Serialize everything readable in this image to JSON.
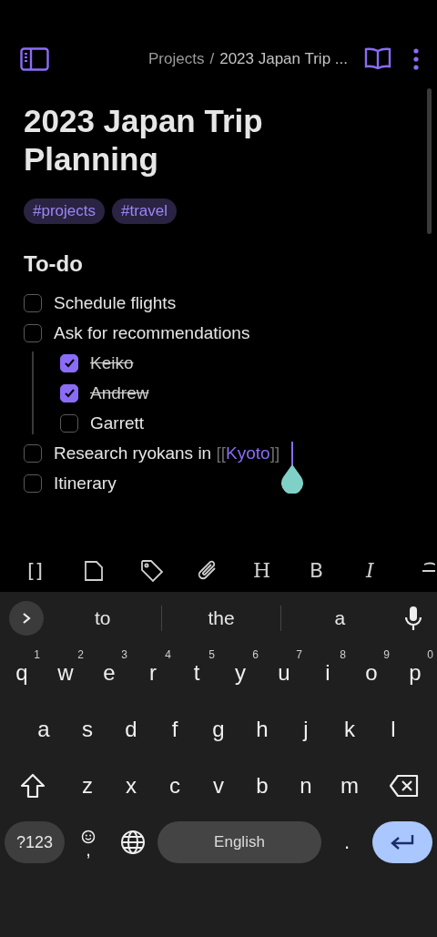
{
  "header": {
    "breadcrumb": [
      {
        "label": "Projects"
      },
      {
        "label": "2023 Japan Trip ..."
      }
    ],
    "separator": "/"
  },
  "note": {
    "title": "2023 Japan Trip Planning",
    "tags": [
      "#projects",
      "#travel"
    ],
    "heading": "To-do",
    "tasks": [
      {
        "text": "Schedule flights",
        "checked": false
      },
      {
        "text": "Ask for recommendations",
        "checked": false,
        "children": [
          {
            "text": "Keiko",
            "checked": true
          },
          {
            "text": "Andrew",
            "checked": true
          },
          {
            "text": "Garrett",
            "checked": false
          }
        ]
      },
      {
        "text": "Research ryokans in",
        "checked": false,
        "link": {
          "open": "[[",
          "label": "Kyoto",
          "close": "]]"
        },
        "cursor": true
      },
      {
        "text": "Itinerary",
        "checked": false
      }
    ]
  },
  "toolbar": [
    {
      "kind": "text",
      "label": "[]"
    },
    {
      "kind": "note"
    },
    {
      "kind": "tag"
    },
    {
      "kind": "attach"
    },
    {
      "kind": "heading",
      "label": "H"
    },
    {
      "kind": "bold",
      "label": "B"
    },
    {
      "kind": "italic",
      "label": "I"
    },
    {
      "kind": "strike"
    }
  ],
  "keyboard": {
    "suggestions": [
      "to",
      "the",
      "a"
    ],
    "rows": [
      [
        {
          "key": "q",
          "hint": "1"
        },
        {
          "key": "w",
          "hint": "2"
        },
        {
          "key": "e",
          "hint": "3"
        },
        {
          "key": "r",
          "hint": "4"
        },
        {
          "key": "t",
          "hint": "5"
        },
        {
          "key": "y",
          "hint": "6"
        },
        {
          "key": "u",
          "hint": "7"
        },
        {
          "key": "i",
          "hint": "8"
        },
        {
          "key": "o",
          "hint": "9"
        },
        {
          "key": "p",
          "hint": "0"
        }
      ],
      [
        {
          "key": "a"
        },
        {
          "key": "s"
        },
        {
          "key": "d"
        },
        {
          "key": "f"
        },
        {
          "key": "g"
        },
        {
          "key": "h"
        },
        {
          "key": "j"
        },
        {
          "key": "k"
        },
        {
          "key": "l"
        }
      ],
      [
        {
          "key": "z"
        },
        {
          "key": "x"
        },
        {
          "key": "c"
        },
        {
          "key": "v"
        },
        {
          "key": "b"
        },
        {
          "key": "n"
        },
        {
          "key": "m"
        }
      ]
    ],
    "symbols_key": "?123",
    "comma_key": ",",
    "space_key": "English",
    "period_key": "."
  }
}
